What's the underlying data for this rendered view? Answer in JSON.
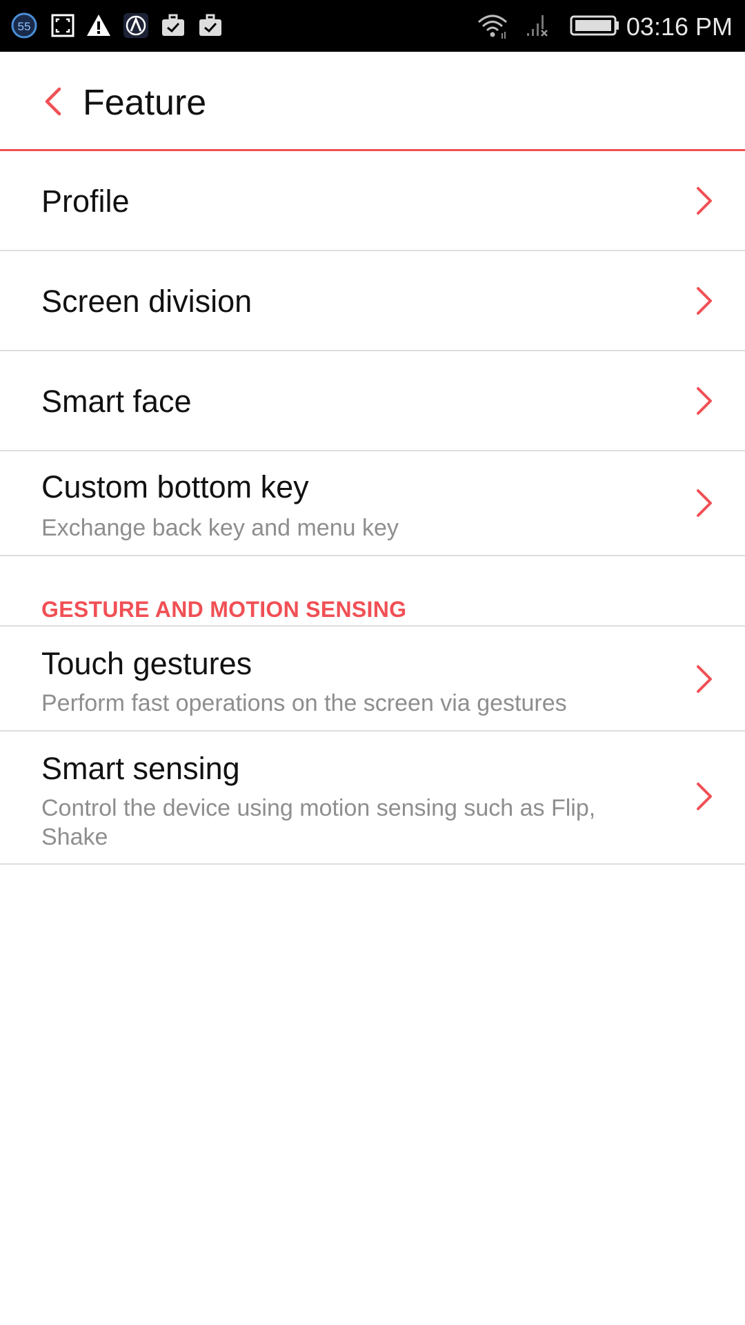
{
  "status_bar": {
    "time": "03:16 PM",
    "left_icons": [
      "badge-55-icon",
      "screenshot-frame-icon",
      "warning-icon",
      "app-a-icon",
      "briefcase-check-icon",
      "briefcase-check-icon"
    ],
    "badge_number": "55",
    "right_icons": [
      "wifi-icon",
      "signal-no-service-icon",
      "battery-icon"
    ]
  },
  "header": {
    "title": "Feature",
    "back_icon": "chevron-left-icon"
  },
  "colors": {
    "accent": "#f05055",
    "title_text": "#111111",
    "subtitle_text": "#8e8e8e",
    "divider": "#dedede"
  },
  "items": [
    {
      "title": "Profile"
    },
    {
      "title": "Screen division"
    },
    {
      "title": "Smart face"
    },
    {
      "title": "Custom bottom key",
      "subtitle": "Exchange back key and menu key"
    }
  ],
  "section": {
    "label": "GESTURE AND MOTION SENSING"
  },
  "section_items": [
    {
      "title": "Touch gestures",
      "subtitle": "Perform fast operations on the screen via gestures"
    },
    {
      "title": "Smart sensing",
      "subtitle": "Control the device using motion sensing such as Flip, Shake"
    }
  ]
}
